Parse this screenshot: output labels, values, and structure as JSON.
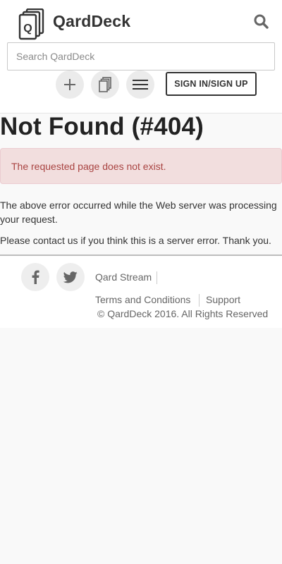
{
  "header": {
    "brand": "QardDeck",
    "logo_letter": "Q",
    "search_placeholder": "Search QardDeck",
    "search_icon": "search-icon",
    "actions": [
      {
        "name": "add",
        "icon": "plus-icon"
      },
      {
        "name": "cards",
        "icon": "cards-icon"
      },
      {
        "name": "menu",
        "icon": "hamburger-icon"
      }
    ],
    "signin_label": "SIGN IN/SIGN UP"
  },
  "main": {
    "title": "Not Found (#404)",
    "alert": "The requested page does not exist.",
    "message1": "The above error occurred while the Web server was processing your request.",
    "message2": "Please contact us if you think this is a server error. Thank you."
  },
  "footer": {
    "social": [
      "facebook-icon",
      "twitter-icon"
    ],
    "links": {
      "qard_stream": "Qard Stream",
      "terms": "Terms and Conditions",
      "support": "Support"
    },
    "copyright": "© QardDeck 2016. All Rights Reserved"
  },
  "colors": {
    "alert_bg": "#f2dede",
    "alert_text": "#a94442",
    "brand_text": "#333333"
  }
}
